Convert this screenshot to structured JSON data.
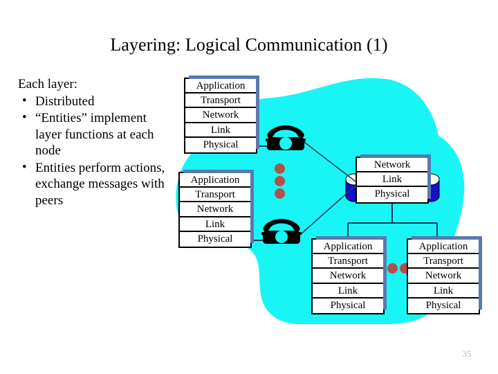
{
  "slide": {
    "title": "Layering: Logical Communication (1)",
    "page_number": "35",
    "background_color": "#ffffff"
  },
  "body": {
    "lead": "Each layer:",
    "bullet_glyph": "•",
    "bullets": [
      "Distributed",
      "“Entities” implement layer functions at each node",
      "Entities perform actions, exchange messages with peers"
    ]
  },
  "diagram": {
    "cloud_color": "#19f5f5",
    "box_shadow_color": "#5b79ae",
    "cylinder_color": "#1111cc",
    "dot_color": "#b35149",
    "line_color": "#1a3a5a",
    "stacks": [
      {
        "id": "host-a",
        "name": "end-host-stack-top-left",
        "layers": [
          "Application",
          "Transport",
          "Network",
          "Link",
          "Physical"
        ]
      },
      {
        "id": "host-b",
        "name": "end-host-stack-mid-left",
        "layers": [
          "Application",
          "Transport",
          "Network",
          "Link",
          "Physical"
        ]
      },
      {
        "id": "router",
        "name": "router-stack",
        "layers": [
          "Network",
          "Link",
          "Physical"
        ]
      },
      {
        "id": "host-c",
        "name": "end-host-stack-bottom-center",
        "layers": [
          "Application",
          "Transport",
          "Network",
          "Link",
          "Physical"
        ]
      },
      {
        "id": "host-d",
        "name": "end-host-stack-bottom-right",
        "layers": [
          "Application",
          "Transport",
          "Network",
          "Link",
          "Physical"
        ]
      }
    ],
    "icons": {
      "phone_top": "telephone-icon",
      "phone_bottom": "telephone-icon",
      "cylinder_left": "network-cylinder-icon",
      "cylinder_right": "network-cylinder-icon"
    },
    "vertical_ellipsis_dots": 3,
    "horizontal_ellipsis_dots": 2
  }
}
